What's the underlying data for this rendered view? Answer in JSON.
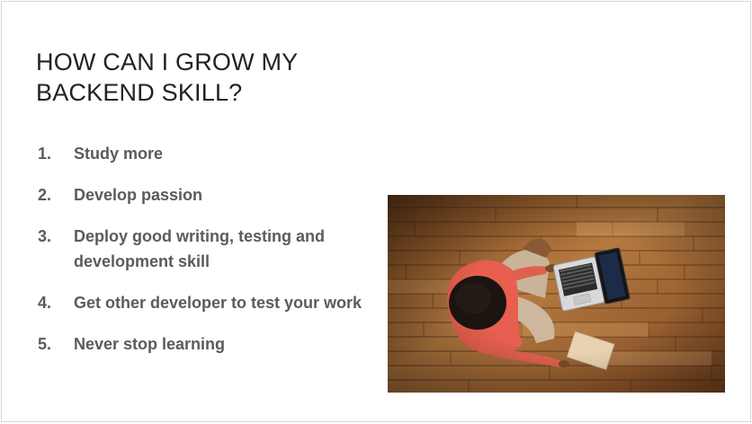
{
  "slide": {
    "title": "HOW CAN I GROW MY BACKEND SKILL?",
    "items": [
      {
        "num": "1.",
        "text": "Study more"
      },
      {
        "num": "2.",
        "text": "Develop passion"
      },
      {
        "num": "3.",
        "text": "Deploy good writing, testing and development skill"
      },
      {
        "num": "4.",
        "text": "Get other developer to test your work"
      },
      {
        "num": "5.",
        "text": "Never stop learning"
      }
    ]
  },
  "colors": {
    "title": "#222222",
    "body_text": "#5b5b5b",
    "floor": "#a8703a",
    "shirt": "#e85f4f"
  }
}
